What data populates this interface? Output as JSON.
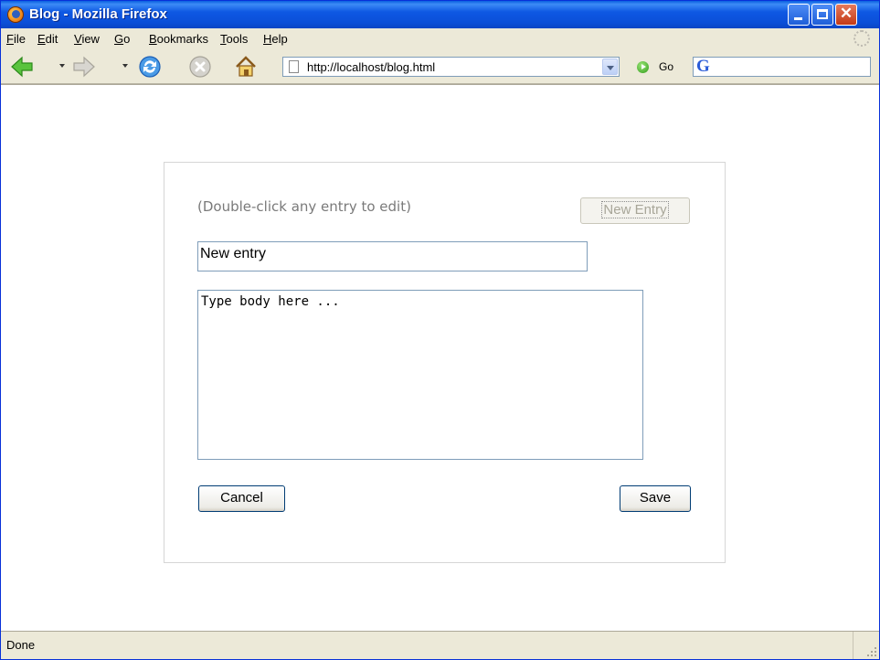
{
  "window": {
    "title": "Blog - Mozilla Firefox"
  },
  "menu": [
    {
      "key": "F",
      "rest": "ile"
    },
    {
      "key": "E",
      "rest": "dit"
    },
    {
      "key": "V",
      "rest": "iew"
    },
    {
      "key": "G",
      "rest": "o"
    },
    {
      "key": "B",
      "rest": "ookmarks"
    },
    {
      "key": "T",
      "rest": "ools"
    },
    {
      "key": "H",
      "rest": "elp"
    }
  ],
  "navigation": {
    "url": "http://localhost/blog.html",
    "go_label": "Go",
    "search_value": ""
  },
  "page": {
    "hint": "(Double-click any entry to edit)",
    "new_entry_label": "New Entry",
    "title_value": "New entry",
    "body_value": "Type body here ...",
    "cancel_label": "Cancel",
    "save_label": "Save"
  },
  "status": {
    "text": "Done"
  },
  "icons": {
    "app": "firefox-icon",
    "back": "back-arrow-icon",
    "forward": "forward-arrow-icon",
    "reload": "reload-icon",
    "stop": "stop-icon",
    "home": "home-icon",
    "go": "go-icon",
    "search_engine": "google-icon",
    "throbber": "throbber-icon"
  },
  "colors": {
    "titlebar": "#0a5fe0",
    "close_button": "#c43a16",
    "hint_text": "#7a7a7a",
    "input_border": "#7f9db9"
  }
}
